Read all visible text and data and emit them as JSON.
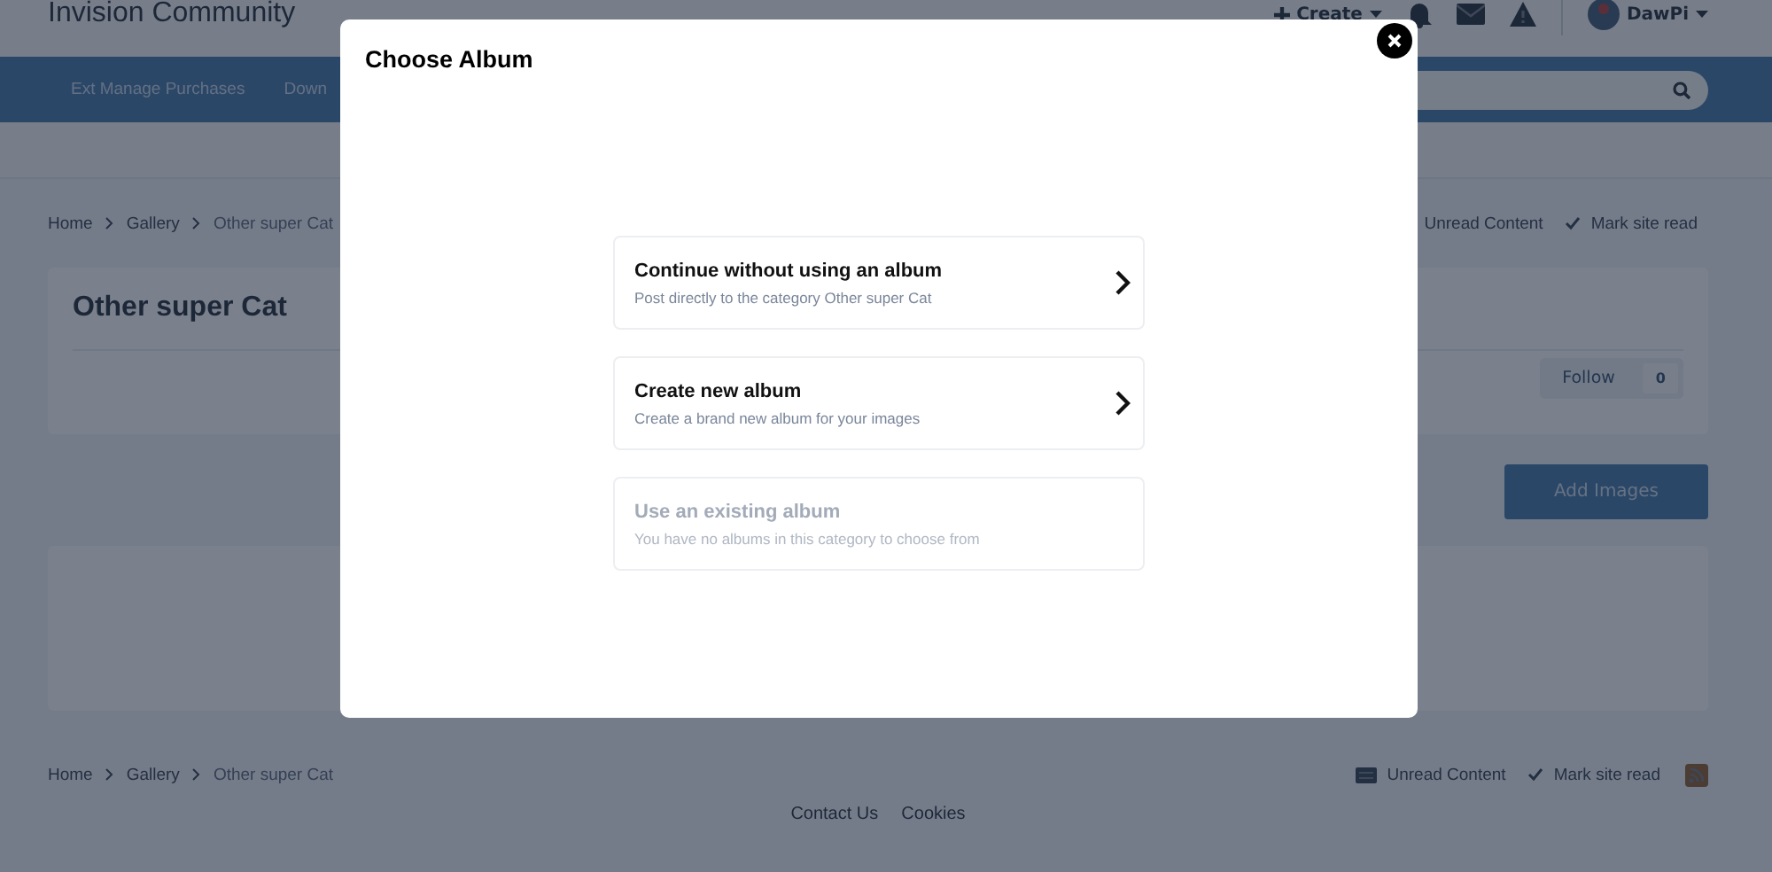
{
  "header": {
    "site_title": "Invision Community",
    "create_label": "Create",
    "user_name": "DawPi"
  },
  "nav": {
    "items": [
      "Ext Manage Purchases",
      "Down"
    ]
  },
  "breadcrumb": {
    "items": [
      "Home",
      "Gallery",
      "Other super Cat"
    ],
    "unread_label": "Unread Content",
    "mark_read_label": "Mark site read"
  },
  "category": {
    "title": "Other super Cat",
    "follow_label": "Follow",
    "follow_count": "0",
    "add_button": "Add Images"
  },
  "footer_breadcrumb": {
    "items": [
      "Home",
      "Gallery",
      "Other super Cat"
    ],
    "unread_label": "Unread Content",
    "mark_read_label": "Mark site read"
  },
  "footer_links": [
    "Contact Us",
    "Cookies"
  ],
  "modal": {
    "title": "Choose Album",
    "options": [
      {
        "title": "Continue without using an album",
        "description": "Post directly to the category Other super Cat",
        "disabled": false
      },
      {
        "title": "Create new album",
        "description": "Create a brand new album for your images",
        "disabled": false
      },
      {
        "title": "Use an existing album",
        "description": "You have no albums in this category to choose from",
        "disabled": true
      }
    ]
  }
}
